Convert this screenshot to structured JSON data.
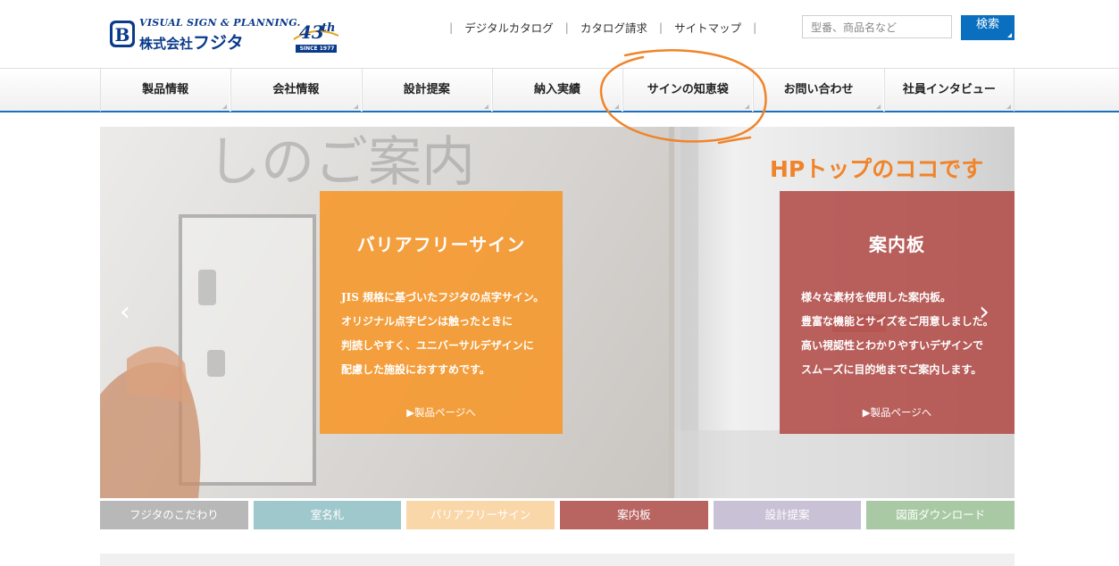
{
  "header": {
    "logo_en": "VISUAL SIGN & PLANNING.",
    "logo_jp_prefix": "株式会社",
    "logo_jp_name": "フジタ",
    "anniversary_number": "43",
    "anniversary_suffix": "th",
    "anniversary_since": "SINCE 1977",
    "top_links": [
      "デジタルカタログ",
      "カタログ請求",
      "サイトマップ"
    ],
    "search_placeholder": "型番、商品名など",
    "search_button": "検索"
  },
  "nav": {
    "items": [
      "製品情報",
      "会社情報",
      "設計提案",
      "納入実績",
      "サインの知恵袋",
      "お問い合わせ",
      "社員インタビュー"
    ]
  },
  "slider": {
    "left_card": {
      "title": "バリアフリーサイン",
      "lines": [
        "JIS 規格に基づいたフジタの点字サイン。",
        "オリジナル点字ピンは触ったときに",
        "判読しやすく、ユニバーサルデザインに",
        "配慮した施設におすすめです。"
      ],
      "link": "▶製品ページへ"
    },
    "right_card": {
      "title": "案内板",
      "lines": [
        "様々な素材を使用した案内板。",
        "豊富な機能とサイズをご用意しました。",
        "高い視認性とわかりやすいデザインで",
        "スムーズに目的地までご案内します。"
      ],
      "link": "▶製品ページへ"
    },
    "prev_arrow": "‹",
    "next_arrow": "›"
  },
  "categories": [
    {
      "label": "フジタのこだわり",
      "color": "#b8b8b8"
    },
    {
      "label": "室名札",
      "color": "#9fc8cc"
    },
    {
      "label": "バリアフリーサイン",
      "color": "#fad7a9"
    },
    {
      "label": "案内板",
      "color": "#b86460"
    },
    {
      "label": "設計提案",
      "color": "#c9c1d5"
    },
    {
      "label": "図面ダウンロード",
      "color": "#a9c9a4"
    }
  ],
  "annotation": {
    "text": "HPトップのココです",
    "color": "#f0842a"
  }
}
